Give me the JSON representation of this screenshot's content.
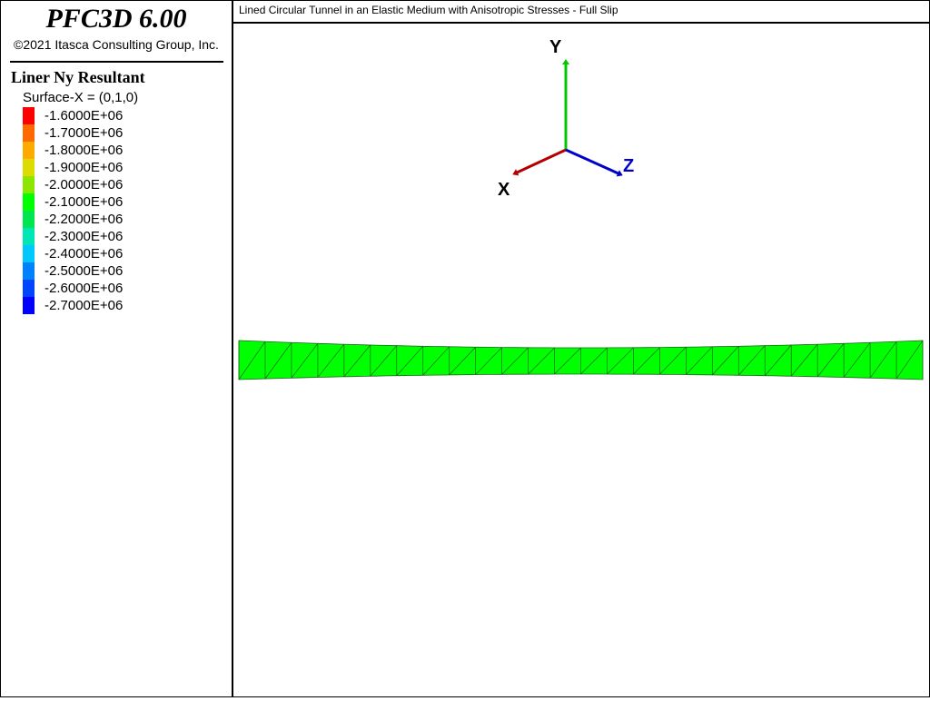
{
  "app": {
    "name": "PFC3D 6.00",
    "copyright": "©2021 Itasca Consulting Group, Inc."
  },
  "plot": {
    "title": "Lined Circular Tunnel in an Elastic Medium with Anisotropic Stresses - Full Slip"
  },
  "legend": {
    "title": "Liner Ny Resultant",
    "subtitle": "Surface-X = (0,1,0)",
    "items": [
      {
        "label": "-1.6000E+06",
        "color": "#ff0000"
      },
      {
        "label": "-1.7000E+06",
        "color": "#ff6a00"
      },
      {
        "label": "-1.8000E+06",
        "color": "#ffaa00"
      },
      {
        "label": "-1.9000E+06",
        "color": "#dcdc00"
      },
      {
        "label": "-2.0000E+06",
        "color": "#8ce600"
      },
      {
        "label": "-2.1000E+06",
        "color": "#00ff00"
      },
      {
        "label": "-2.2000E+06",
        "color": "#00e650"
      },
      {
        "label": "-2.3000E+06",
        "color": "#00e6b4"
      },
      {
        "label": "-2.4000E+06",
        "color": "#00c8ff"
      },
      {
        "label": "-2.5000E+06",
        "color": "#0082ff"
      },
      {
        "label": "-2.6000E+06",
        "color": "#0046ff"
      },
      {
        "label": "-2.7000E+06",
        "color": "#0000ff"
      }
    ]
  },
  "axes": {
    "x": {
      "label": "X",
      "color": "#b40000"
    },
    "y": {
      "label": "Y",
      "color": "#00c800"
    },
    "z": {
      "label": "Z",
      "color": "#0000c8"
    }
  },
  "liner": {
    "fill_color": "#00ff00",
    "edge_color": "#1a661a"
  }
}
